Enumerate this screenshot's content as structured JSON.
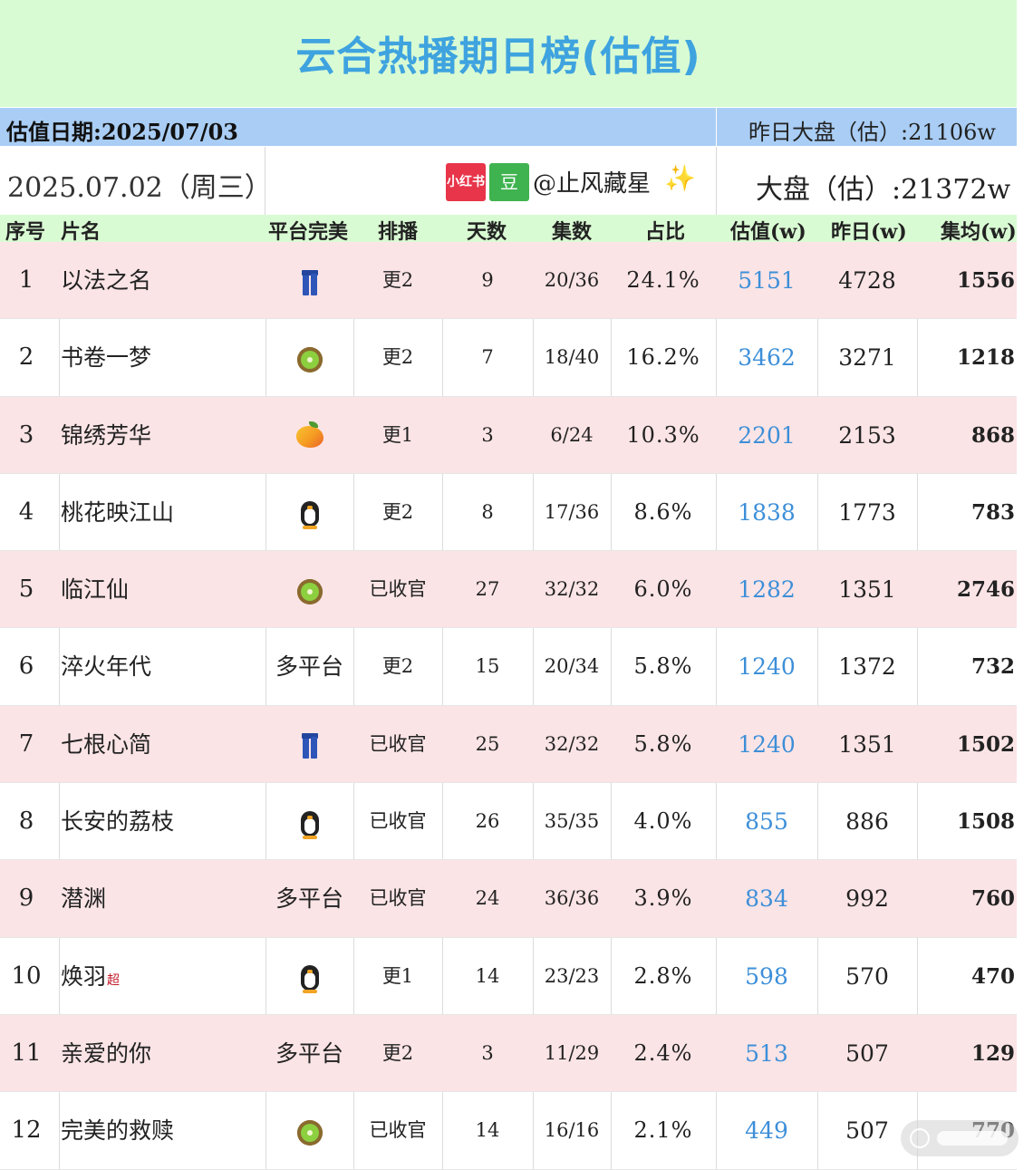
{
  "title": "云合热播期日榜(估值)",
  "estimate_date": "估值日期:2025/07/03",
  "yesterday_market": "昨日大盘（估）:21106w",
  "broadcast_date": "2025.07.02（周三）",
  "badges": {
    "xiaohongshu": "小红书",
    "douban": "豆"
  },
  "author": "@止风藏星",
  "sparkle_icon": "✨",
  "market_today": "大盘（估）:21372w",
  "columns": [
    "序号",
    "片名",
    "平台完美",
    "排播",
    "天数",
    "集数",
    "占比",
    "估值(w)",
    "昨日(w)",
    "集均(w)"
  ],
  "colors": {
    "title": "#3ea3df",
    "estimate": "#3d8fd8",
    "pink_row": "#fbe4e6",
    "header_green": "#d9fbd3",
    "date_blue": "#a9cdf4"
  },
  "rows": [
    {
      "rank": "1",
      "name": "以法之名",
      "tag": "",
      "platform_icon": "jeans",
      "platform": "",
      "schedule": "更2",
      "days": "9",
      "episodes": "20/36",
      "share": "24.1%",
      "estimate": "5151",
      "yesterday": "4728",
      "avg": "1556"
    },
    {
      "rank": "2",
      "name": "书卷一梦",
      "tag": "",
      "platform_icon": "kiwi",
      "platform": "",
      "schedule": "更2",
      "days": "7",
      "episodes": "18/40",
      "share": "16.2%",
      "estimate": "3462",
      "yesterday": "3271",
      "avg": "1218"
    },
    {
      "rank": "3",
      "name": "锦绣芳华",
      "tag": "",
      "platform_icon": "mango",
      "platform": "",
      "schedule": "更1",
      "days": "3",
      "episodes": "6/24",
      "share": "10.3%",
      "estimate": "2201",
      "yesterday": "2153",
      "avg": "868"
    },
    {
      "rank": "4",
      "name": "桃花映江山",
      "tag": "",
      "platform_icon": "penguin",
      "platform": "",
      "schedule": "更2",
      "days": "8",
      "episodes": "17/36",
      "share": "8.6%",
      "estimate": "1838",
      "yesterday": "1773",
      "avg": "783"
    },
    {
      "rank": "5",
      "name": "临江仙",
      "tag": "",
      "platform_icon": "kiwi",
      "platform": "",
      "schedule": "已收官",
      "days": "27",
      "episodes": "32/32",
      "share": "6.0%",
      "estimate": "1282",
      "yesterday": "1351",
      "avg": "2746"
    },
    {
      "rank": "6",
      "name": "淬火年代",
      "tag": "",
      "platform_icon": "",
      "platform": "多平台",
      "schedule": "更2",
      "days": "15",
      "episodes": "20/34",
      "share": "5.8%",
      "estimate": "1240",
      "yesterday": "1372",
      "avg": "732"
    },
    {
      "rank": "7",
      "name": "七根心简",
      "tag": "",
      "platform_icon": "jeans",
      "platform": "",
      "schedule": "已收官",
      "days": "25",
      "episodes": "32/32",
      "share": "5.8%",
      "estimate": "1240",
      "yesterday": "1351",
      "avg": "1502"
    },
    {
      "rank": "8",
      "name": "长安的荔枝",
      "tag": "",
      "platform_icon": "penguin",
      "platform": "",
      "schedule": "已收官",
      "days": "26",
      "episodes": "35/35",
      "share": "4.0%",
      "estimate": "855",
      "yesterday": "886",
      "avg": "1508"
    },
    {
      "rank": "9",
      "name": "潜渊",
      "tag": "",
      "platform_icon": "",
      "platform": "多平台",
      "schedule": "已收官",
      "days": "24",
      "episodes": "36/36",
      "share": "3.9%",
      "estimate": "834",
      "yesterday": "992",
      "avg": "760"
    },
    {
      "rank": "10",
      "name": "焕羽",
      "tag": "超",
      "platform_icon": "penguin",
      "platform": "",
      "schedule": "更1",
      "days": "14",
      "episodes": "23/23",
      "share": "2.8%",
      "estimate": "598",
      "yesterday": "570",
      "avg": "470"
    },
    {
      "rank": "11",
      "name": "亲爱的你",
      "tag": "",
      "platform_icon": "",
      "platform": "多平台",
      "schedule": "更2",
      "days": "3",
      "episodes": "11/29",
      "share": "2.4%",
      "estimate": "513",
      "yesterday": "507",
      "avg": "129"
    },
    {
      "rank": "12",
      "name": "完美的救赎",
      "tag": "",
      "platform_icon": "kiwi",
      "platform": "",
      "schedule": "已收官",
      "days": "14",
      "episodes": "16/16",
      "share": "2.1%",
      "estimate": "449",
      "yesterday": "507",
      "avg": "770"
    }
  ]
}
